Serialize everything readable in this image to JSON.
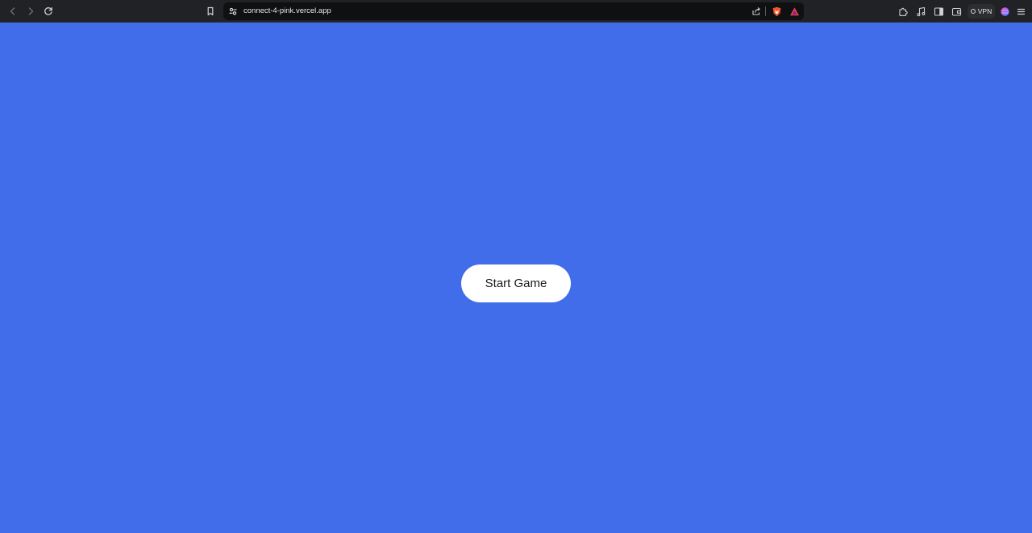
{
  "browser": {
    "url": "connect-4-pink.vercel.app",
    "vpn_label": "VPN",
    "colors": {
      "toolbar_bg": "#202226",
      "url_bar_bg": "#0f1012",
      "icon": "#cfcfcf",
      "icon_disabled": "#6b6d70"
    },
    "icons": [
      "back-icon",
      "forward-icon",
      "reload-icon",
      "bookmark-icon",
      "site-info-icon",
      "share-icon",
      "brave-shields-icon",
      "brave-rewards-icon",
      "extensions-icon",
      "media-icon",
      "sidebar-icon",
      "wallet-icon",
      "profile-icon",
      "menu-icon"
    ]
  },
  "page": {
    "background": "#416cea",
    "start_button_label": "Start Game"
  }
}
